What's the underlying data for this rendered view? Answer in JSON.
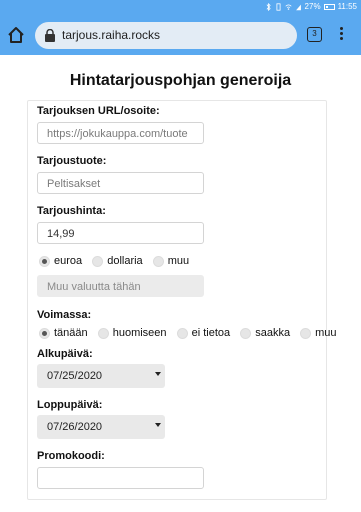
{
  "status_bar": {
    "battery_percent": "27%",
    "time": "11:55"
  },
  "browser": {
    "url": "tarjous.raiha.rocks",
    "tab_count": "3"
  },
  "page": {
    "title": "Hintatarjouspohjan generoija",
    "url_label": "Tarjouksen URL/osoite:",
    "url_placeholder": "https://jokukauppa.com/tuote",
    "product_label": "Tarjoustuote:",
    "product_placeholder": "Peltisakset",
    "price_label": "Tarjoushinta:",
    "price_value": "14,99",
    "currency_options": [
      "euroa",
      "dollaria",
      "muu"
    ],
    "currency_selected": "euroa",
    "other_currency_placeholder": "Muu valuutta tähän",
    "validity_label": "Voimassa:",
    "validity_options": [
      "tänään",
      "huomiseen",
      "ei tietoa",
      "saakka",
      "muu"
    ],
    "validity_selected": "tänään",
    "start_label": "Alkupäivä:",
    "start_value": "07/25/2020",
    "end_label": "Loppupäivä:",
    "end_value": "07/26/2020",
    "promo_label": "Promokoodi:",
    "promo_value": ""
  }
}
